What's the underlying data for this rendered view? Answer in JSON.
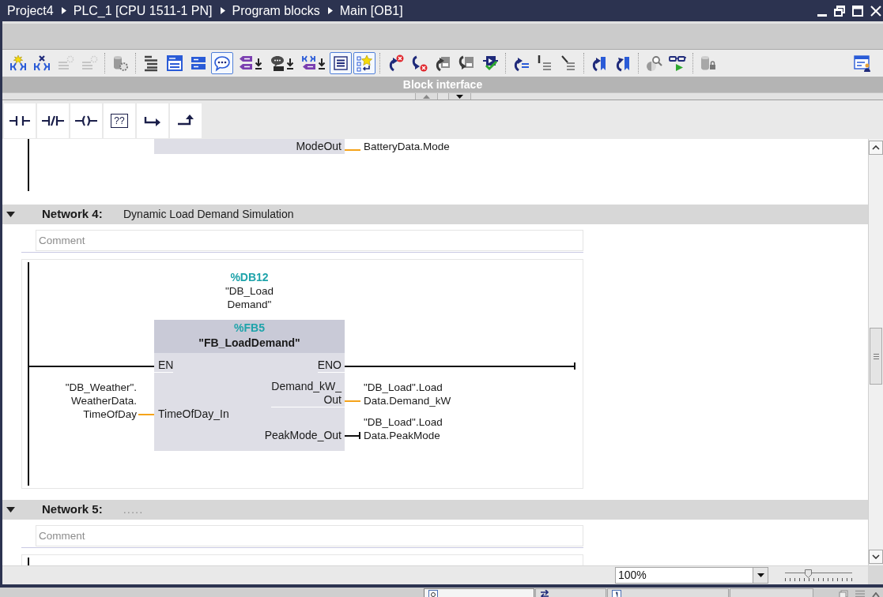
{
  "title_bar": {
    "breadcrumb": [
      "Project4",
      "PLC_1 [CPU 1511-1 PN]",
      "Program blocks",
      "Main [OB1]"
    ]
  },
  "toolbar": {
    "groups": [
      [
        {
          "on": false,
          "disabled": false
        },
        {
          "on": false,
          "disabled": false
        },
        {
          "on": false,
          "disabled": true
        },
        {
          "on": false,
          "disabled": true
        }
      ],
      [
        {
          "on": false,
          "disabled": false
        }
      ],
      [
        {
          "on": false,
          "disabled": false
        },
        {
          "on": false,
          "disabled": false
        },
        {
          "on": false,
          "disabled": false
        },
        {
          "on": true,
          "disabled": false
        },
        {
          "on": false,
          "disabled": false
        },
        {
          "on": false,
          "disabled": false
        },
        {
          "on": false,
          "disabled": false
        },
        {
          "on": true,
          "disabled": false
        },
        {
          "on": true,
          "disabled": false
        }
      ],
      [
        {
          "on": false,
          "disabled": false
        },
        {
          "on": false,
          "disabled": false
        },
        {
          "on": false,
          "disabled": false
        },
        {
          "on": false,
          "disabled": false
        },
        {
          "on": false,
          "disabled": false
        }
      ],
      [
        {
          "on": false,
          "disabled": false
        },
        {
          "on": false,
          "disabled": false
        },
        {
          "on": false,
          "disabled": false
        }
      ],
      [
        {
          "on": false,
          "disabled": false
        },
        {
          "on": false,
          "disabled": false
        }
      ],
      [
        {
          "on": false,
          "disabled": false
        },
        {
          "on": false,
          "disabled": false
        }
      ],
      [
        {
          "on": false,
          "disabled": false
        }
      ]
    ],
    "end": [
      {
        "on": false,
        "disabled": false
      }
    ]
  },
  "interface_bar": {
    "title": "Block interface"
  },
  "palette": [
    {
      "kind": "contact"
    },
    {
      "kind": "negated_contact"
    },
    {
      "kind": "coil"
    },
    {
      "kind": "box",
      "label": "??"
    },
    {
      "kind": "open_branch"
    },
    {
      "kind": "close_branch"
    }
  ],
  "previous_network": {
    "outputs": [
      {
        "pin": [
          "ModeOut"
        ],
        "kind": "data",
        "operand": [
          "BatteryData.Mode"
        ]
      }
    ]
  },
  "networks": [
    {
      "title": "Network 4:",
      "description": "Dynamic Load Demand Simulation",
      "expanded": true,
      "comment": {
        "placeholder": "Comment"
      },
      "block": {
        "instance_address": "%DB12",
        "instance_name": [
          "\"DB_Load",
          "Demand\""
        ],
        "address": "%FB5",
        "name": "\"FB_LoadDemand\"",
        "inputs": [
          {
            "pin": [
              "EN"
            ],
            "kind": "power"
          },
          {
            "pin": [
              "TimeOfDay_In"
            ],
            "kind": "data",
            "operand": [
              "\"DB_Weather\".",
              "WeatherData.",
              "TimeOfDay"
            ]
          }
        ],
        "outputs": [
          {
            "pin": [
              "ENO"
            ],
            "kind": "power"
          },
          {
            "pin": [
              "Demand_kW_",
              "Out"
            ],
            "kind": "data",
            "operand": [
              "\"DB_Load\".Load",
              "Data.Demand_kW"
            ]
          },
          {
            "pin": [
              "PeakMode_Out"
            ],
            "kind": "bool",
            "operand": [
              "\"DB_Load\".Load",
              "Data.PeakMode"
            ]
          }
        ]
      }
    },
    {
      "title": "Network 5:",
      "title_field": {
        "placeholder": "....."
      },
      "expanded": true,
      "comment": {
        "placeholder": "Comment"
      }
    }
  ],
  "zoom": {
    "value": "100%",
    "slider": {
      "level": 0.34
    }
  },
  "panel_tabs": [
    {
      "selected": true
    },
    {
      "selected": false
    },
    {
      "selected": false
    },
    {
      "selected": false
    }
  ]
}
